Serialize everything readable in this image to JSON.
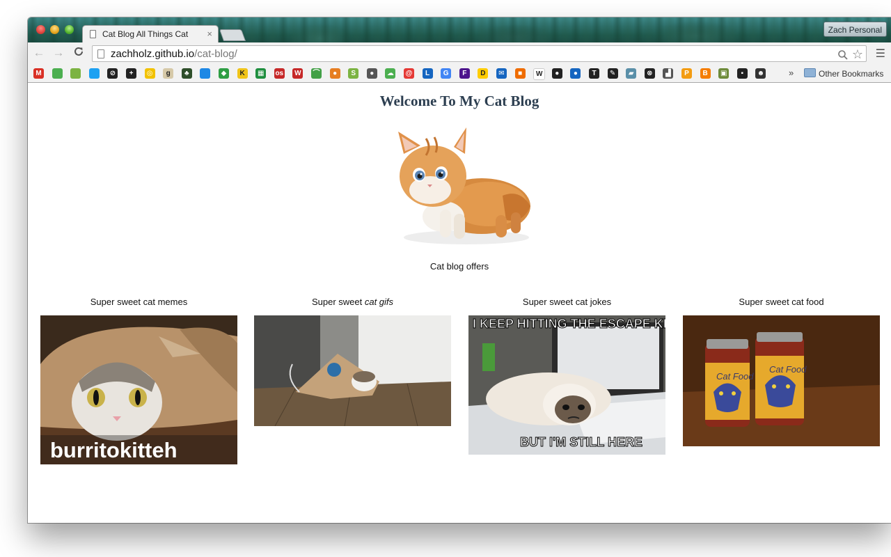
{
  "browser": {
    "tab_title": "Cat Blog All Things Cat",
    "tab_close": "×",
    "profile_name": "Zach Personal",
    "url_host": "zachholz.github.io",
    "url_path": "/cat-blog/",
    "back_glyph": "←",
    "forward_glyph": "→",
    "reload_glyph": "C",
    "menu_glyph": "☰",
    "zoom_glyph": "⌕",
    "star_glyph": "☆",
    "more_glyph": "»",
    "other_bookmarks": "Other Bookmarks"
  },
  "bookmarks": [
    {
      "icon": "gmail-icon",
      "glyph": "M",
      "color": "#d93025"
    },
    {
      "icon": "maps-icon",
      "glyph": "",
      "color": "#4caf50"
    },
    {
      "icon": "android-icon",
      "glyph": "",
      "color": "#7cb342"
    },
    {
      "icon": "twitter-icon",
      "glyph": "",
      "color": "#1da1f2"
    },
    {
      "icon": "circle-slash-icon",
      "glyph": "⊘",
      "color": "#222222"
    },
    {
      "icon": "plus-icon",
      "glyph": "+",
      "color": "#222222"
    },
    {
      "icon": "target-icon",
      "glyph": "◎",
      "color": "#f2c200"
    },
    {
      "icon": "goodreads-icon",
      "glyph": "g",
      "color": "#d6c9a8"
    },
    {
      "icon": "tree-icon",
      "glyph": "♣",
      "color": "#2e4e2a"
    },
    {
      "icon": "blue-square-icon",
      "glyph": "",
      "color": "#1e88e5"
    },
    {
      "icon": "leaf-icon",
      "glyph": "◆",
      "color": "#2e9e44"
    },
    {
      "icon": "kmhd-icon",
      "glyph": "K",
      "color": "#f0c419"
    },
    {
      "icon": "sheets-icon",
      "glyph": "▦",
      "color": "#1e8e3e"
    },
    {
      "icon": "os-icon",
      "glyph": "os",
      "color": "#c62828"
    },
    {
      "icon": "w-icon",
      "glyph": "W",
      "color": "#c62828"
    },
    {
      "icon": "arc-icon",
      "glyph": "⌒",
      "color": "#43a047"
    },
    {
      "icon": "acorn-icon",
      "glyph": "●",
      "color": "#e67e22"
    },
    {
      "icon": "shopify-icon",
      "glyph": "S",
      "color": "#7cb342"
    },
    {
      "icon": "chimp-icon",
      "glyph": "●",
      "color": "#555555"
    },
    {
      "icon": "cloud-icon",
      "glyph": "☁",
      "color": "#4caf50"
    },
    {
      "icon": "circle-a-icon",
      "glyph": "@",
      "color": "#e53935"
    },
    {
      "icon": "tl-icon",
      "glyph": "L",
      "color": "#1565c0"
    },
    {
      "icon": "google-icon",
      "glyph": "G",
      "color": "#4285f4"
    },
    {
      "icon": "fedex-icon",
      "glyph": "F",
      "color": "#4d148c"
    },
    {
      "icon": "dhl-icon",
      "glyph": "D",
      "color": "#ffcc00"
    },
    {
      "icon": "mail-icon",
      "glyph": "✉",
      "color": "#1565c0"
    },
    {
      "icon": "box-icon",
      "glyph": "■",
      "color": "#ef6c00"
    },
    {
      "icon": "wikipedia-icon",
      "glyph": "W",
      "color": "#ffffff"
    },
    {
      "icon": "circle-bar-icon",
      "glyph": "●",
      "color": "#222222"
    },
    {
      "icon": "person-icon",
      "glyph": "●",
      "color": "#1565c0"
    },
    {
      "icon": "nyt-icon",
      "glyph": "T",
      "color": "#222222"
    },
    {
      "icon": "pen-icon",
      "glyph": "✎",
      "color": "#222222"
    },
    {
      "icon": "parallelogram-icon",
      "glyph": "▰",
      "color": "#5a8fa8"
    },
    {
      "icon": "bike-icon",
      "glyph": "⊗",
      "color": "#222222"
    },
    {
      "icon": "chart-icon",
      "glyph": "▟",
      "color": "#555555"
    },
    {
      "icon": "p-icon",
      "glyph": "P",
      "color": "#f39c12"
    },
    {
      "icon": "blogger-icon",
      "glyph": "B",
      "color": "#f57d00"
    },
    {
      "icon": "photo-icon",
      "glyph": "▣",
      "color": "#6d8a3a"
    },
    {
      "icon": "square-yellow-icon",
      "glyph": "▪",
      "color": "#222222"
    },
    {
      "icon": "ghost-icon",
      "glyph": "☻",
      "color": "#333333"
    }
  ],
  "page": {
    "title": "Welcome To My Cat Blog",
    "offers": "Cat blog offers",
    "cards": [
      {
        "label": "Super sweet cat memes",
        "caption": "burritokitteh"
      },
      {
        "label_a": "Super sweet ",
        "label_b": "cat gifs"
      },
      {
        "label": "Super sweet cat jokes",
        "top_text": "I KEEP HITTING THE ESCAPE KEY...",
        "bottom_text": "BUT I'M STILL HERE"
      },
      {
        "label": "Super sweet cat food",
        "jar_text": "Cat Food"
      }
    ]
  }
}
